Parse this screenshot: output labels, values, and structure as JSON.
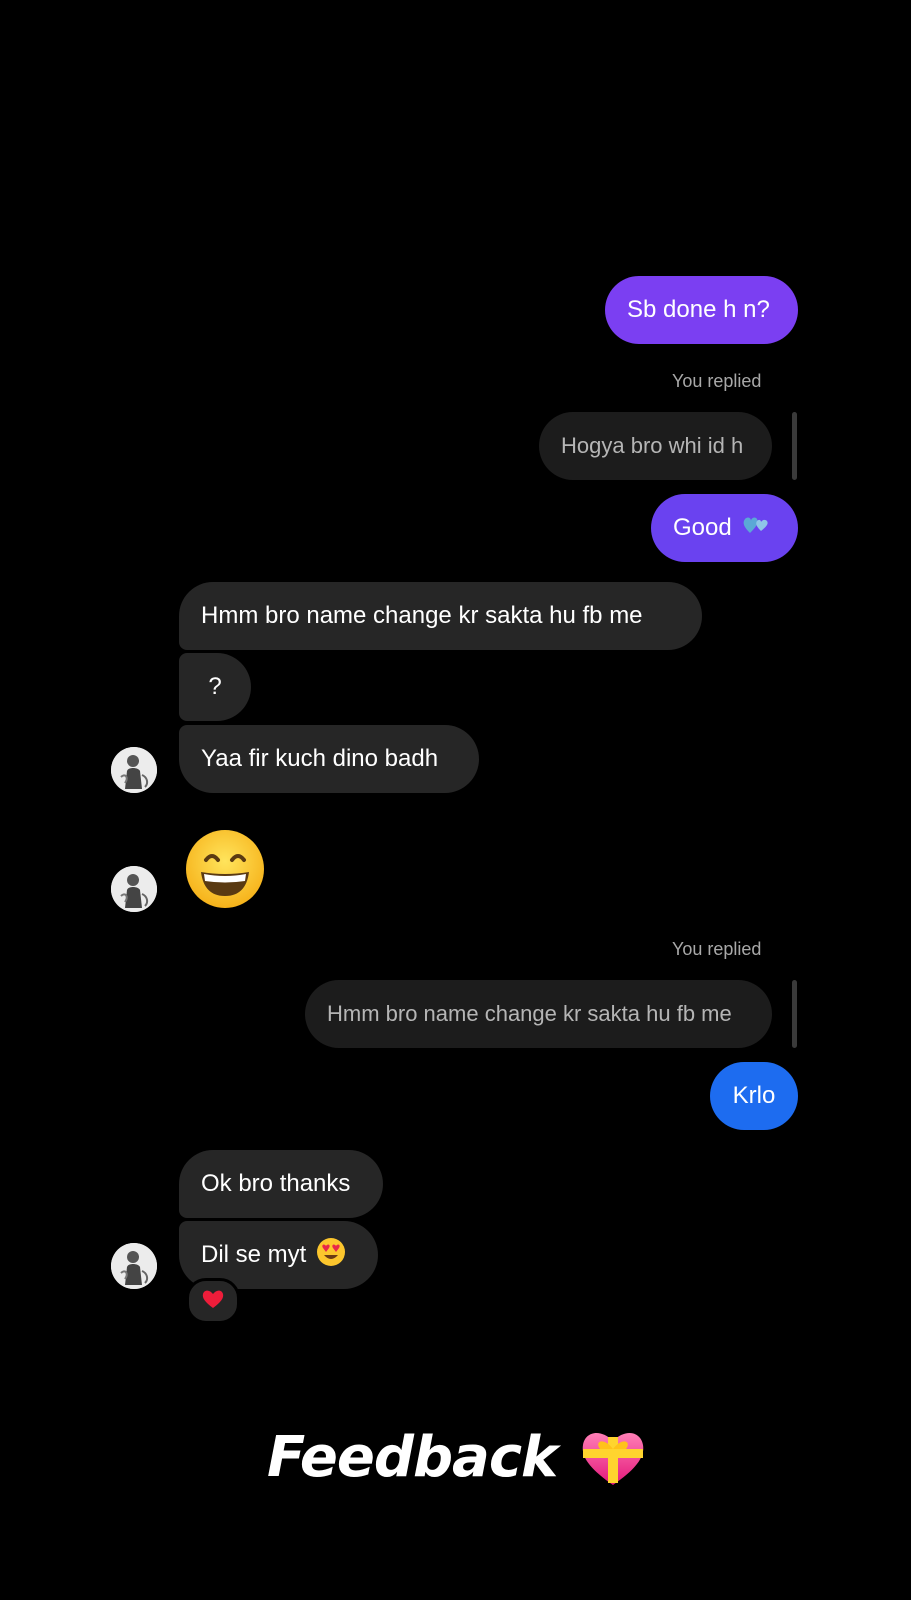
{
  "messages": {
    "m1": {
      "text": "Sb done h n?",
      "direction": "sent"
    },
    "reply1": {
      "label": "You replied",
      "quote": "Hogya bro whi id h"
    },
    "m2": {
      "text": "Good",
      "emoji": "hearts-emoji",
      "direction": "sent"
    },
    "m3": {
      "text": "Hmm bro name change kr sakta hu fb me",
      "direction": "received"
    },
    "m4": {
      "text": "?",
      "direction": "received"
    },
    "m5": {
      "text": "Yaa fir kuch dino badh",
      "direction": "received"
    },
    "m6": {
      "emoji": "grinning-face-emoji",
      "direction": "received"
    },
    "reply2": {
      "label": "You replied",
      "quote": "Hmm bro name change kr sakta hu fb me"
    },
    "m7": {
      "text": "Krlo",
      "direction": "sent"
    },
    "m8": {
      "text": "Ok bro thanks",
      "direction": "received"
    },
    "m9": {
      "text": "Dil se myt",
      "emoji": "heart-eyes-emoji",
      "reaction": "red-heart-icon",
      "direction": "received"
    }
  },
  "footer": {
    "title": "Feedback",
    "emoji": "gift-heart-emoji"
  },
  "colors": {
    "background": "#000000",
    "sent_purple": "#7b3ff2",
    "sent_violet": "#6a42f0",
    "sent_blue": "#1d6cf0",
    "received": "#262626",
    "reply_quote": "#1c1c1c"
  }
}
